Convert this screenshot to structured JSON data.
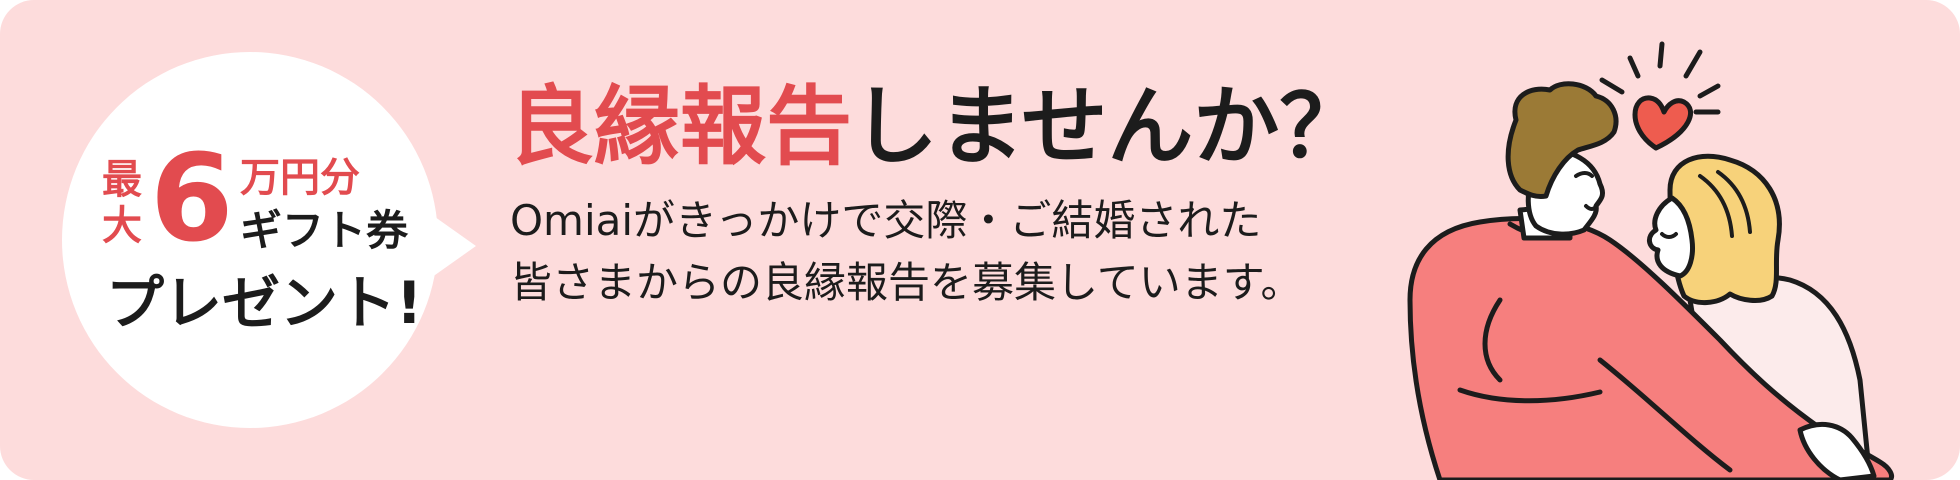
{
  "badge": {
    "saidai_top": "最",
    "saidai_bottom": "大",
    "amount": "6",
    "unit": "万円分",
    "gift": "ギフト券",
    "present": "プレゼント!"
  },
  "headline": {
    "accent": "良縁報告",
    "rest": "しませんか？"
  },
  "body": {
    "line1": "Omiaiがきっかけで交際・ご結婚された",
    "line2": "皆さまからの良縁報告を募集しています。"
  },
  "colors": {
    "background": "#fddcdc",
    "accent": "#e24b4f",
    "text": "#1c1c1c",
    "bubble": "#ffffff",
    "jacket": "#f67f7e",
    "hair_man": "#9b7a36",
    "hair_woman": "#f7d27a",
    "heart": "#ee5c4f"
  },
  "illustration": {
    "subject": "couple-hugging-illustration"
  }
}
